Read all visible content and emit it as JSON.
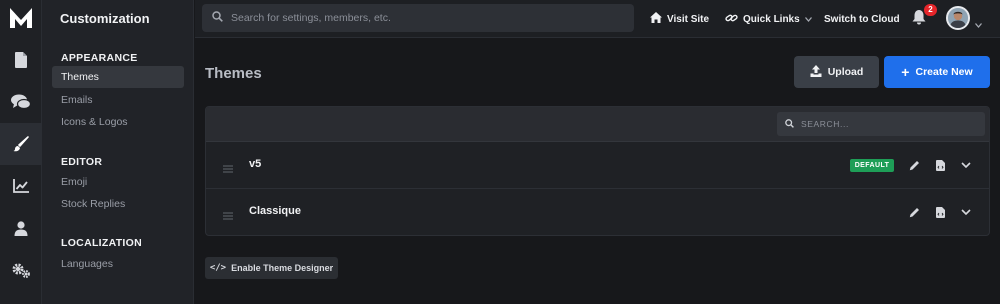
{
  "rail": {
    "logo_icon": "logo-mark-icon",
    "items": [
      {
        "icon": "document-icon"
      },
      {
        "icon": "chat-icon"
      },
      {
        "icon": "brush-icon",
        "active": true
      },
      {
        "icon": "chart-line-icon"
      },
      {
        "icon": "user-icon"
      },
      {
        "icon": "cogs-icon"
      }
    ]
  },
  "sidebar": {
    "title": "Customization",
    "sections": [
      {
        "heading": "APPEARANCE",
        "items": [
          "Themes",
          "Emails",
          "Icons & Logos"
        ]
      },
      {
        "heading": "EDITOR",
        "items": [
          "Emoji",
          "Stock Replies"
        ]
      },
      {
        "heading": "LOCALIZATION",
        "items": [
          "Languages"
        ]
      }
    ],
    "active_item": "Themes"
  },
  "topbar": {
    "search_placeholder": "Search for settings, members, etc.",
    "visit_site": "Visit Site",
    "quick_links": "Quick Links",
    "switch_cloud": "Switch to Cloud",
    "notification_count": "2"
  },
  "main": {
    "title": "Themes",
    "upload_label": "Upload",
    "create_label": "Create New",
    "table_search_placeholder": "SEARCH...",
    "themes": [
      {
        "name": "v5",
        "badge": "DEFAULT"
      },
      {
        "name": "Classique",
        "badge": ""
      }
    ],
    "designer_button": "Enable Theme Designer"
  },
  "colors": {
    "accent": "#1f6feb",
    "badge_default": "#1e9e57",
    "notification": "#e5252a"
  }
}
